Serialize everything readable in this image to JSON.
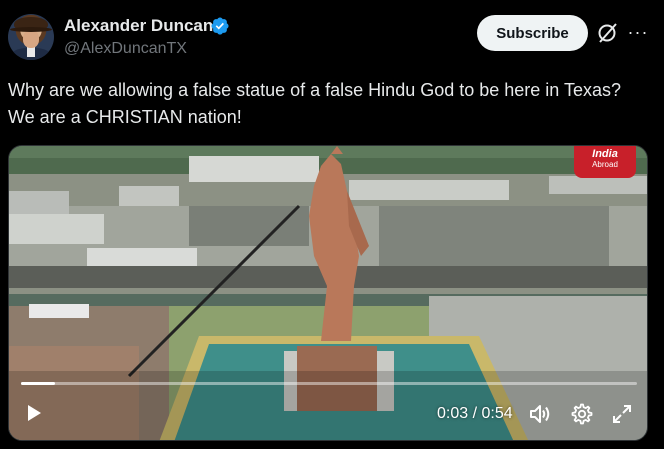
{
  "author": {
    "name": "Alexander Duncan",
    "handle": "@AlexDuncanTX",
    "verified": true,
    "verified_color": "#1d9bf0"
  },
  "actions": {
    "subscribe_label": "Subscribe",
    "grok_icon": "grok-icon",
    "more_icon": "more-icon"
  },
  "post": {
    "text": "Why are we allowing a false statue of a false Hindu God to be here in Texas? We are a CHRISTIAN nation!"
  },
  "video": {
    "current_time": "0:03",
    "duration": "0:54",
    "separator": " / ",
    "progress_fraction": 0.055,
    "watermark_line1": "India",
    "watermark_line2": "Abroad",
    "watermark_color": "#c8202a",
    "controls": [
      "play-icon",
      "volume-icon",
      "settings-icon",
      "fullscreen-icon"
    ]
  },
  "colors": {
    "background": "#000000",
    "text": "#e7e9ea",
    "muted": "#71767b",
    "subscribe_bg": "#eff3f4"
  }
}
